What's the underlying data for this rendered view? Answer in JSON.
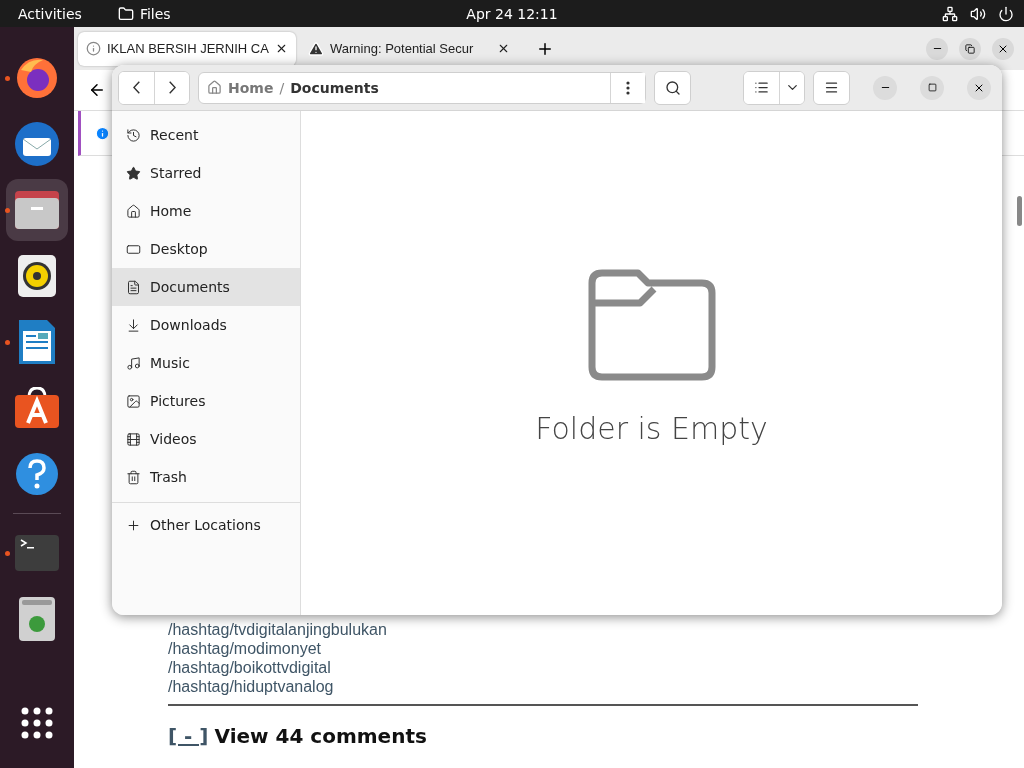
{
  "top_bar": {
    "activities": "Activities",
    "app_name": "Files",
    "clock": "Apr 24  12:11"
  },
  "dock": [
    {
      "kind": "firefox",
      "running": true,
      "selected": false
    },
    {
      "kind": "mail",
      "running": false,
      "selected": false
    },
    {
      "kind": "files",
      "running": true,
      "selected": true
    },
    {
      "kind": "speaker",
      "running": false,
      "selected": false
    },
    {
      "kind": "writer",
      "running": true,
      "selected": false
    },
    {
      "kind": "store",
      "running": false,
      "selected": false
    },
    {
      "kind": "help",
      "running": false,
      "selected": false
    },
    {
      "kind": "terminal",
      "running": true,
      "selected": false
    },
    {
      "kind": "trash",
      "running": false,
      "selected": false
    },
    {
      "kind": "apps",
      "running": false,
      "selected": false
    }
  ],
  "browser": {
    "tabs": [
      {
        "title": "IKLAN BERSIH JERNIH CA",
        "kind": "site",
        "selected": true
      },
      {
        "title": "Warning: Potential Secur",
        "kind": "warning",
        "selected": false
      }
    ],
    "links": [
      "/hashtag/tvdigitalanjingbulukan",
      "/hashtag/modimonyet",
      "/hashtag/boikottvdigital",
      "/hashtag/hiduptvanalog"
    ],
    "comments": {
      "toggle": "[ - ]",
      "label": "View 44 comments"
    }
  },
  "files": {
    "path": [
      "Home",
      "Documents"
    ],
    "path_separator": "/",
    "sidebar": [
      {
        "label": "Recent",
        "kind": "recent",
        "selected": false
      },
      {
        "label": "Starred",
        "kind": "starred",
        "selected": false
      },
      {
        "label": "Home",
        "kind": "home",
        "selected": false
      },
      {
        "label": "Desktop",
        "kind": "desktop",
        "selected": false
      },
      {
        "label": "Documents",
        "kind": "documents",
        "selected": true
      },
      {
        "label": "Downloads",
        "kind": "downloads",
        "selected": false
      },
      {
        "label": "Music",
        "kind": "music",
        "selected": false
      },
      {
        "label": "Pictures",
        "kind": "pictures",
        "selected": false
      },
      {
        "label": "Videos",
        "kind": "videos",
        "selected": false
      },
      {
        "label": "Trash",
        "kind": "trash",
        "selected": false
      }
    ],
    "other_locations": "Other Locations",
    "empty_message": "Folder is Empty"
  }
}
